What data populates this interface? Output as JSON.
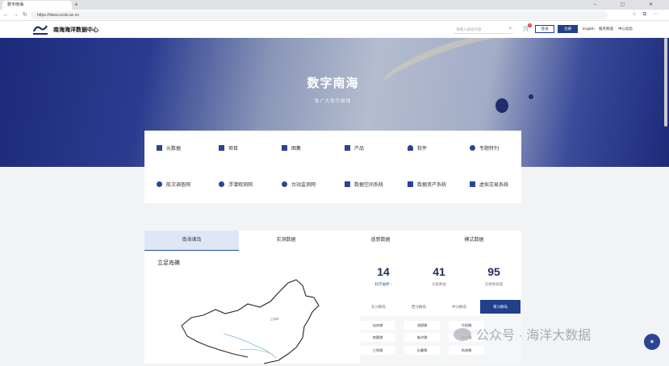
{
  "browser": {
    "tab_title": "数字南海",
    "new_tab": "+",
    "url": "https://dsea.scsio.ac.cn",
    "window_controls": "–  ▢  ✕"
  },
  "header": {
    "site_title": "南海海洋数据中心",
    "search_placeholder": "请输入搜索内容",
    "cart_count": "0",
    "login_label": "登录",
    "register_label": "注册",
    "links": [
      "English",
      "服务频道",
      "中心动态"
    ]
  },
  "hero": {
    "title": "数字南海",
    "subtitle": "致广大而尽精微"
  },
  "quick_links": {
    "row1": [
      {
        "label": "元数据",
        "icon": "file-icon"
      },
      {
        "label": "项目",
        "icon": "folder-icon"
      },
      {
        "label": "图集",
        "icon": "image-icon"
      },
      {
        "label": "产品",
        "icon": "grid-icon"
      },
      {
        "label": "软件",
        "icon": "cloud-icon"
      },
      {
        "label": "专题特刊",
        "icon": "target-icon"
      }
    ],
    "row2": [
      {
        "label": "航次调查网",
        "icon": "compass-icon"
      },
      {
        "label": "浮潜观测网",
        "icon": "person-icon"
      },
      {
        "label": "台站监测网",
        "icon": "location-icon"
      },
      {
        "label": "数据空间系统",
        "icon": "monitor-icon"
      },
      {
        "label": "数据资产系统",
        "icon": "diamond-icon"
      },
      {
        "label": "虚拟交易系统",
        "icon": "screen-icon"
      }
    ]
  },
  "tabs": [
    "南海诸岛",
    "实测数据",
    "遥感数据",
    "模式数据"
  ],
  "active_tab": 0,
  "section": {
    "title": "立足岛礁"
  },
  "stats": [
    {
      "num": "14",
      "label": "科学站所 ›"
    },
    {
      "num": "41",
      "label": "岛礁数据"
    },
    {
      "num": "95",
      "label": "岛礁数据量"
    }
  ],
  "segments": [
    "东沙群岛",
    "西沙群岛",
    "中沙群岛",
    "南沙群岛"
  ],
  "active_segment": 3,
  "islands": [
    [
      "仙宾礁",
      "渚碧礁",
      "华阳礁"
    ],
    [
      "南薰礁",
      "美济礁",
      "赤瓜礁"
    ],
    [
      "三角礁",
      "永暑礁",
      "南海礁"
    ]
  ],
  "map_label": "兰州市",
  "watermark": "公众号 · 海洋大数据",
  "colors": {
    "brand": "#223f8c",
    "tab_active_bg": "#dfe7f6"
  }
}
